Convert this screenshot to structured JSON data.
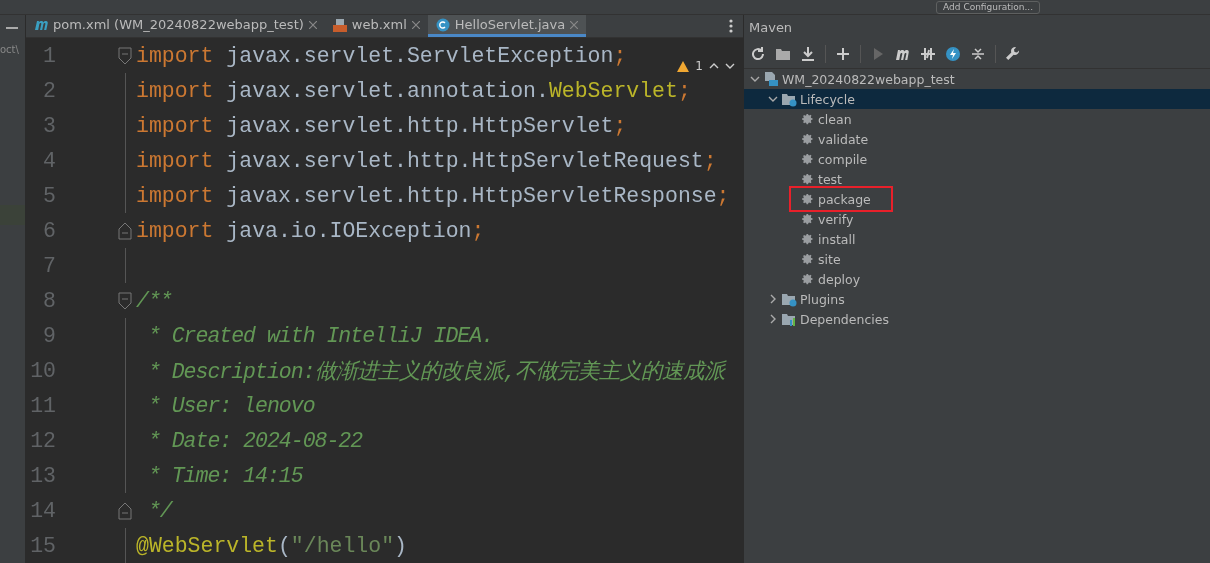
{
  "toolbar": {
    "run_config": "Add Configuration..."
  },
  "project_panel": {
    "path_fragment": "oct\\"
  },
  "tabs": [
    {
      "label": "pom.xml (WM_20240822webapp_test)",
      "kind": "maven",
      "selected": false
    },
    {
      "label": "web.xml",
      "kind": "xml",
      "selected": false
    },
    {
      "label": "HelloServlet.java",
      "kind": "java",
      "selected": true
    }
  ],
  "editor": {
    "warnings": "1",
    "lines": [
      {
        "number": "1",
        "fold_start": true,
        "tokens": [
          {
            "kind": "keyword",
            "text": "import "
          },
          {
            "kind": "plain",
            "text": "javax.servlet.ServletException"
          },
          {
            "kind": "keyword",
            "text": ";"
          }
        ]
      },
      {
        "number": "2",
        "tokens": [
          {
            "kind": "keyword",
            "text": "import "
          },
          {
            "kind": "plain",
            "text": "javax.servlet.annotation."
          },
          {
            "kind": "annotation",
            "text": "WebServlet"
          },
          {
            "kind": "keyword",
            "text": ";"
          }
        ]
      },
      {
        "number": "3",
        "tokens": [
          {
            "kind": "keyword",
            "text": "import "
          },
          {
            "kind": "plain",
            "text": "javax.servlet.http.HttpServlet"
          },
          {
            "kind": "keyword",
            "text": ";"
          }
        ]
      },
      {
        "number": "4",
        "tokens": [
          {
            "kind": "keyword",
            "text": "import "
          },
          {
            "kind": "plain",
            "text": "javax.servlet.http.HttpServletRequest"
          },
          {
            "kind": "keyword",
            "text": ";"
          }
        ]
      },
      {
        "number": "5",
        "tokens": [
          {
            "kind": "keyword",
            "text": "import "
          },
          {
            "kind": "plain",
            "text": "javax.servlet.http.HttpServletResponse"
          },
          {
            "kind": "keyword",
            "text": ";"
          }
        ]
      },
      {
        "number": "6",
        "fold_end": true,
        "tokens": [
          {
            "kind": "keyword",
            "text": "import "
          },
          {
            "kind": "plain",
            "text": "java.io.IOException"
          },
          {
            "kind": "keyword",
            "text": ";"
          }
        ]
      },
      {
        "number": "7"
      },
      {
        "number": "8",
        "fold_start": true,
        "tokens": [
          {
            "kind": "comment",
            "text": "/**"
          }
        ]
      },
      {
        "number": "9",
        "tokens": [
          {
            "kind": "comment",
            "text": " * Created with IntelliJ IDEA."
          }
        ]
      },
      {
        "number": "10",
        "tokens": [
          {
            "kind": "comment",
            "text": " * Description:做渐进主义的改良派,不做完美主义的速成派"
          }
        ]
      },
      {
        "number": "11",
        "tokens": [
          {
            "kind": "comment",
            "text": " * User: lenovo"
          }
        ]
      },
      {
        "number": "12",
        "tokens": [
          {
            "kind": "comment",
            "text": " * Date: 2024-08-22"
          }
        ]
      },
      {
        "number": "13",
        "tokens": [
          {
            "kind": "comment",
            "text": " * Time: 14:15"
          }
        ]
      },
      {
        "number": "14",
        "fold_end": true,
        "tokens": [
          {
            "kind": "comment",
            "text": " */"
          }
        ]
      },
      {
        "number": "15",
        "tokens": [
          {
            "kind": "annotation",
            "text": "@WebServlet"
          },
          {
            "kind": "plain",
            "text": "("
          },
          {
            "kind": "string",
            "text": "\"/hello\""
          },
          {
            "kind": "plain",
            "text": ")"
          }
        ]
      }
    ]
  },
  "maven": {
    "title": "Maven",
    "tree": [
      {
        "label": "WM_20240822webapp_test",
        "kind": "project",
        "expanded": true,
        "selected": false,
        "children": [
          {
            "label": "Lifecycle",
            "kind": "lifecycle",
            "expanded": true,
            "selected": true,
            "children": [
              {
                "label": "clean",
                "kind": "goal",
                "highlighted": false
              },
              {
                "label": "validate",
                "kind": "goal",
                "highlighted": false
              },
              {
                "label": "compile",
                "kind": "goal",
                "highlighted": false
              },
              {
                "label": "test",
                "kind": "goal",
                "highlighted": false
              },
              {
                "label": "package",
                "kind": "goal",
                "highlighted": true
              },
              {
                "label": "verify",
                "kind": "goal",
                "highlighted": false
              },
              {
                "label": "install",
                "kind": "goal",
                "highlighted": false
              },
              {
                "label": "site",
                "kind": "goal",
                "highlighted": false
              },
              {
                "label": "deploy",
                "kind": "goal",
                "highlighted": false
              }
            ]
          },
          {
            "label": "Plugins",
            "kind": "plugins",
            "expanded": false,
            "selected": false
          },
          {
            "label": "Dependencies",
            "kind": "dependencies",
            "expanded": false,
            "selected": false
          }
        ]
      }
    ]
  }
}
